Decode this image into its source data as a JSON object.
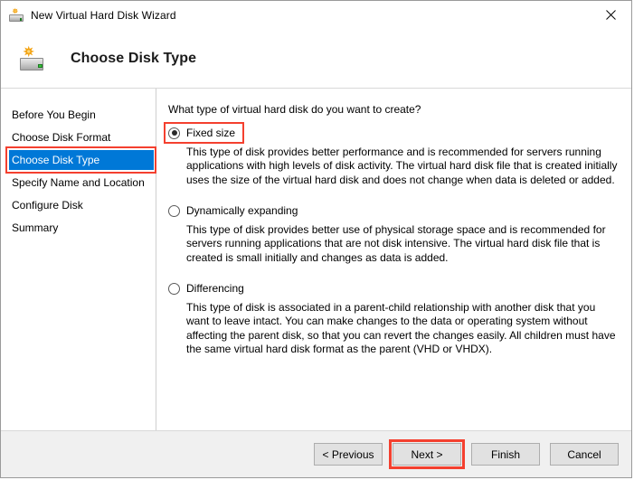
{
  "window": {
    "title": "New Virtual Hard Disk Wizard",
    "icon": "hard-disk-new-icon",
    "close_label": "✕"
  },
  "header": {
    "title": "Choose Disk Type",
    "icon": "hard-disk-new-icon"
  },
  "sidebar": {
    "items": [
      {
        "label": "Before You Begin",
        "selected": false
      },
      {
        "label": "Choose Disk Format",
        "selected": false
      },
      {
        "label": "Choose Disk Type",
        "selected": true
      },
      {
        "label": "Specify Name and Location",
        "selected": false
      },
      {
        "label": "Configure Disk",
        "selected": false
      },
      {
        "label": "Summary",
        "selected": false
      }
    ],
    "selected_index": 2
  },
  "main": {
    "question": "What type of virtual hard disk do you want to create?",
    "options": [
      {
        "label": "Fixed size",
        "checked": true,
        "annotated": true,
        "description": "This type of disk provides better performance and is recommended for servers running applications with high levels of disk activity. The virtual hard disk file that is created initially uses the size of the virtual hard disk and does not change when data is deleted or added."
      },
      {
        "label": "Dynamically expanding",
        "checked": false,
        "annotated": false,
        "description": "This type of disk provides better use of physical storage space and is recommended for servers running applications that are not disk intensive. The virtual hard disk file that is created is small initially and changes as data is added."
      },
      {
        "label": "Differencing",
        "checked": false,
        "annotated": false,
        "description": "This type of disk is associated in a parent-child relationship with another disk that you want to leave intact. You can make changes to the data or operating system without affecting the parent disk, so that you can revert the changes easily. All children must have the same virtual hard disk format as the parent (VHD or VHDX)."
      }
    ]
  },
  "footer": {
    "buttons": [
      {
        "label": "< Previous",
        "annotated": false
      },
      {
        "label": "Next >",
        "annotated": true
      },
      {
        "label": "Finish",
        "annotated": false
      },
      {
        "label": "Cancel",
        "annotated": false
      }
    ]
  },
  "colors": {
    "accent_blue": "#0078d7",
    "annotation_red": "#f4402f",
    "footer_grey": "#f0f0f0",
    "button_grey": "#e1e1e1"
  }
}
